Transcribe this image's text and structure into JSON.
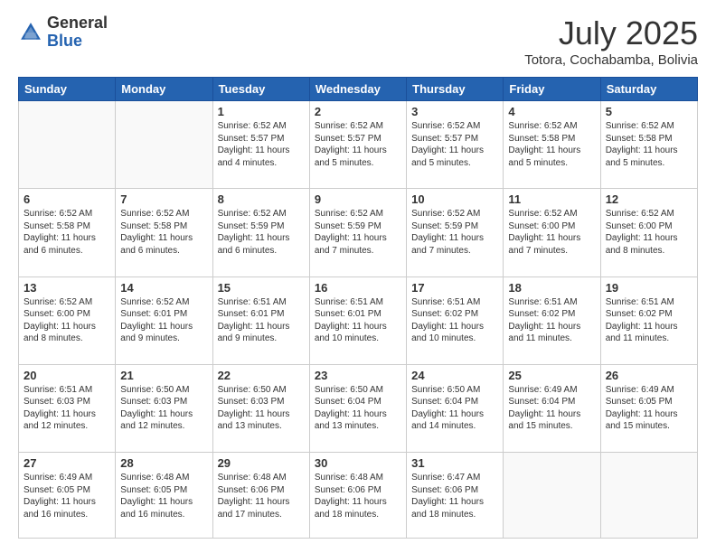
{
  "header": {
    "logo_general": "General",
    "logo_blue": "Blue",
    "month": "July 2025",
    "location": "Totora, Cochabamba, Bolivia"
  },
  "weekdays": [
    "Sunday",
    "Monday",
    "Tuesday",
    "Wednesday",
    "Thursday",
    "Friday",
    "Saturday"
  ],
  "weeks": [
    [
      {
        "day": "",
        "info": ""
      },
      {
        "day": "",
        "info": ""
      },
      {
        "day": "1",
        "info": "Sunrise: 6:52 AM\nSunset: 5:57 PM\nDaylight: 11 hours and 4 minutes."
      },
      {
        "day": "2",
        "info": "Sunrise: 6:52 AM\nSunset: 5:57 PM\nDaylight: 11 hours and 5 minutes."
      },
      {
        "day": "3",
        "info": "Sunrise: 6:52 AM\nSunset: 5:57 PM\nDaylight: 11 hours and 5 minutes."
      },
      {
        "day": "4",
        "info": "Sunrise: 6:52 AM\nSunset: 5:58 PM\nDaylight: 11 hours and 5 minutes."
      },
      {
        "day": "5",
        "info": "Sunrise: 6:52 AM\nSunset: 5:58 PM\nDaylight: 11 hours and 5 minutes."
      }
    ],
    [
      {
        "day": "6",
        "info": "Sunrise: 6:52 AM\nSunset: 5:58 PM\nDaylight: 11 hours and 6 minutes."
      },
      {
        "day": "7",
        "info": "Sunrise: 6:52 AM\nSunset: 5:58 PM\nDaylight: 11 hours and 6 minutes."
      },
      {
        "day": "8",
        "info": "Sunrise: 6:52 AM\nSunset: 5:59 PM\nDaylight: 11 hours and 6 minutes."
      },
      {
        "day": "9",
        "info": "Sunrise: 6:52 AM\nSunset: 5:59 PM\nDaylight: 11 hours and 7 minutes."
      },
      {
        "day": "10",
        "info": "Sunrise: 6:52 AM\nSunset: 5:59 PM\nDaylight: 11 hours and 7 minutes."
      },
      {
        "day": "11",
        "info": "Sunrise: 6:52 AM\nSunset: 6:00 PM\nDaylight: 11 hours and 7 minutes."
      },
      {
        "day": "12",
        "info": "Sunrise: 6:52 AM\nSunset: 6:00 PM\nDaylight: 11 hours and 8 minutes."
      }
    ],
    [
      {
        "day": "13",
        "info": "Sunrise: 6:52 AM\nSunset: 6:00 PM\nDaylight: 11 hours and 8 minutes."
      },
      {
        "day": "14",
        "info": "Sunrise: 6:52 AM\nSunset: 6:01 PM\nDaylight: 11 hours and 9 minutes."
      },
      {
        "day": "15",
        "info": "Sunrise: 6:51 AM\nSunset: 6:01 PM\nDaylight: 11 hours and 9 minutes."
      },
      {
        "day": "16",
        "info": "Sunrise: 6:51 AM\nSunset: 6:01 PM\nDaylight: 11 hours and 10 minutes."
      },
      {
        "day": "17",
        "info": "Sunrise: 6:51 AM\nSunset: 6:02 PM\nDaylight: 11 hours and 10 minutes."
      },
      {
        "day": "18",
        "info": "Sunrise: 6:51 AM\nSunset: 6:02 PM\nDaylight: 11 hours and 11 minutes."
      },
      {
        "day": "19",
        "info": "Sunrise: 6:51 AM\nSunset: 6:02 PM\nDaylight: 11 hours and 11 minutes."
      }
    ],
    [
      {
        "day": "20",
        "info": "Sunrise: 6:51 AM\nSunset: 6:03 PM\nDaylight: 11 hours and 12 minutes."
      },
      {
        "day": "21",
        "info": "Sunrise: 6:50 AM\nSunset: 6:03 PM\nDaylight: 11 hours and 12 minutes."
      },
      {
        "day": "22",
        "info": "Sunrise: 6:50 AM\nSunset: 6:03 PM\nDaylight: 11 hours and 13 minutes."
      },
      {
        "day": "23",
        "info": "Sunrise: 6:50 AM\nSunset: 6:04 PM\nDaylight: 11 hours and 13 minutes."
      },
      {
        "day": "24",
        "info": "Sunrise: 6:50 AM\nSunset: 6:04 PM\nDaylight: 11 hours and 14 minutes."
      },
      {
        "day": "25",
        "info": "Sunrise: 6:49 AM\nSunset: 6:04 PM\nDaylight: 11 hours and 15 minutes."
      },
      {
        "day": "26",
        "info": "Sunrise: 6:49 AM\nSunset: 6:05 PM\nDaylight: 11 hours and 15 minutes."
      }
    ],
    [
      {
        "day": "27",
        "info": "Sunrise: 6:49 AM\nSunset: 6:05 PM\nDaylight: 11 hours and 16 minutes."
      },
      {
        "day": "28",
        "info": "Sunrise: 6:48 AM\nSunset: 6:05 PM\nDaylight: 11 hours and 16 minutes."
      },
      {
        "day": "29",
        "info": "Sunrise: 6:48 AM\nSunset: 6:06 PM\nDaylight: 11 hours and 17 minutes."
      },
      {
        "day": "30",
        "info": "Sunrise: 6:48 AM\nSunset: 6:06 PM\nDaylight: 11 hours and 18 minutes."
      },
      {
        "day": "31",
        "info": "Sunrise: 6:47 AM\nSunset: 6:06 PM\nDaylight: 11 hours and 18 minutes."
      },
      {
        "day": "",
        "info": ""
      },
      {
        "day": "",
        "info": ""
      }
    ]
  ]
}
